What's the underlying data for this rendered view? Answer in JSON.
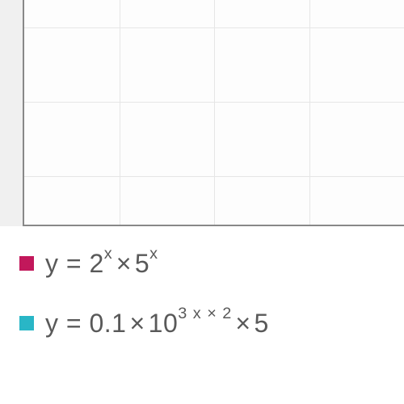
{
  "chart_data": {
    "type": "line",
    "series": [
      {
        "name": "y = 2^x × 5^x",
        "color": "#c2185b",
        "formula_parts": {
          "lead": "y = 2",
          "exp1": "x",
          "mid": "5",
          "exp2": "x",
          "tail": ""
        }
      },
      {
        "name": "y = 0.1 × 10^(3x×2) × 5",
        "color": "#29b6c6",
        "formula_parts": {
          "lead": "y = 0.1",
          "mid": "10",
          "exp2": "3 x × 2",
          "tail": "5"
        }
      }
    ],
    "grid": {
      "cols": 4,
      "rows": 3
    },
    "title": "",
    "xlabel": "",
    "ylabel": ""
  },
  "symbols": {
    "mult": "×"
  }
}
